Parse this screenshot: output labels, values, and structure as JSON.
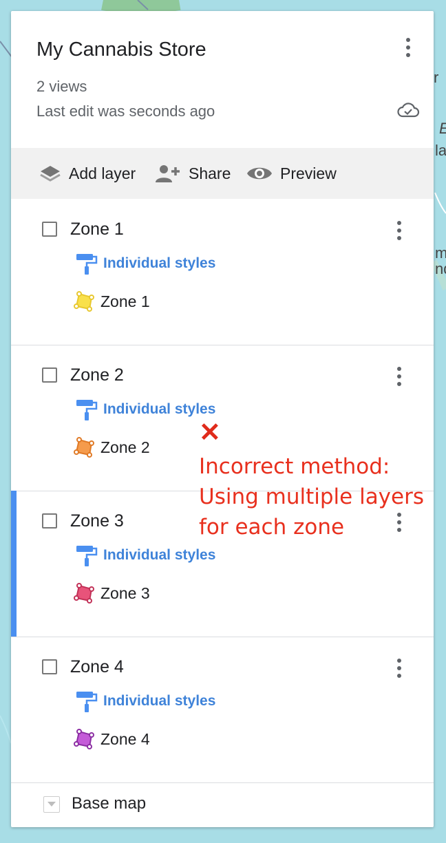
{
  "map": {
    "edge_letters": [
      "r",
      "E",
      "la",
      "m",
      "nd"
    ]
  },
  "header": {
    "title": "My Cannabis Store",
    "views": "2 views",
    "last_edit": "Last edit was seconds ago"
  },
  "toolbar": {
    "add_layer": "Add layer",
    "share": "Share",
    "preview": "Preview"
  },
  "layers": [
    {
      "title": "Zone 1",
      "style_label": "Individual styles",
      "feature": "Zone 1",
      "color": "#f9e04b",
      "selected": false
    },
    {
      "title": "Zone 2",
      "style_label": "Individual styles",
      "feature": "Zone 2",
      "color": "#f59b4c",
      "selected": false
    },
    {
      "title": "Zone 3",
      "style_label": "Individual styles",
      "feature": "Zone 3",
      "color": "#e8537a",
      "selected": true
    },
    {
      "title": "Zone 4",
      "style_label": "Individual styles",
      "feature": "Zone 4",
      "color": "#c45ad8",
      "selected": false
    }
  ],
  "basemap": {
    "label": "Base map"
  },
  "annotation": {
    "mark": "✕",
    "lines": [
      "Incorrect method:",
      "Using multiple layers",
      "for each zone"
    ],
    "color": "#e8301e"
  },
  "colors": {
    "accent": "#4a8ff0",
    "link": "#3f83d9"
  }
}
